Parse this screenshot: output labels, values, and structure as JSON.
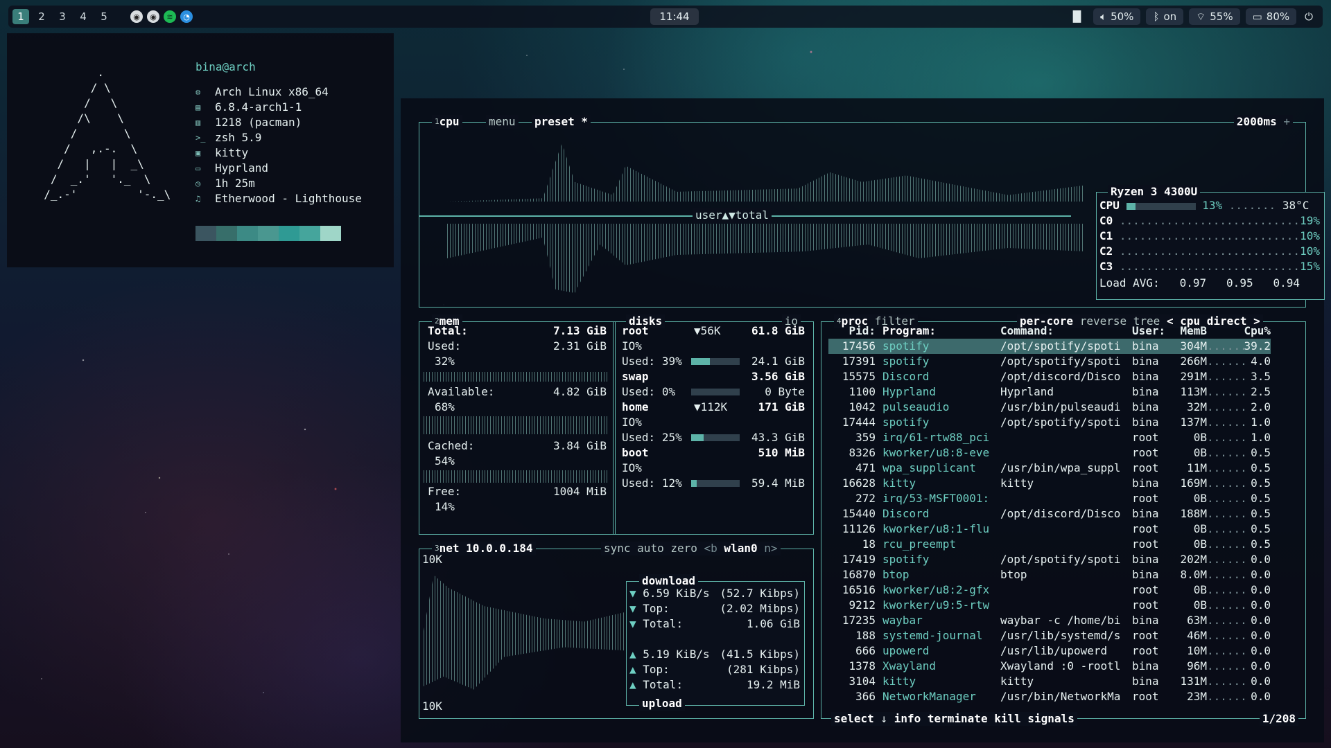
{
  "bar": {
    "workspaces": [
      "1",
      "2",
      "3",
      "4",
      "5"
    ],
    "active_workspace": "1",
    "clock": "11:44",
    "volume": "50%",
    "bluetooth": "on",
    "wifi": "55%",
    "battery": "80%",
    "tray_icons": [
      "obs-icon",
      "obs-icon",
      "spotify-icon",
      "edge-icon"
    ]
  },
  "fetch": {
    "header": "bina@arch",
    "rows": [
      {
        "icon": "arch-icon",
        "value": "Arch Linux x86_64"
      },
      {
        "icon": "kernel-icon",
        "value": "6.8.4-arch1-1"
      },
      {
        "icon": "package-icon",
        "value": "1218 (pacman)"
      },
      {
        "icon": "shell-icon",
        "value": "zsh 5.9"
      },
      {
        "icon": "terminal-icon",
        "value": "kitty"
      },
      {
        "icon": "window-icon",
        "value": "Hyprland"
      },
      {
        "icon": "clock-icon",
        "value": "1h 25m"
      },
      {
        "icon": "music-icon",
        "value": "Etherwood - Lighthouse"
      }
    ],
    "swatches": [
      "#3b5560",
      "#376e6a",
      "#3c8a85",
      "#4a9790",
      "#2f9a94",
      "#45a59c",
      "#9fd6c8"
    ]
  },
  "cpu": {
    "tab_num": "1",
    "tab": "cpu",
    "menu": "menu",
    "preset": "preset *",
    "interval": "2000ms",
    "graph_label": "user▲▼total",
    "model": "Ryzen 3 4300U",
    "rows": [
      {
        "name": "CPU",
        "pct": "13%",
        "temp": "38°C",
        "frac": 0.13
      },
      {
        "name": "C0",
        "pct": "19%"
      },
      {
        "name": "C1",
        "pct": "10%"
      },
      {
        "name": "C2",
        "pct": "10%"
      },
      {
        "name": "C3",
        "pct": "15%"
      }
    ],
    "load_label": "Load AVG:",
    "load": [
      "0.97",
      "0.95",
      "0.94"
    ]
  },
  "mem": {
    "tab_num": "2",
    "tab": "mem",
    "total_label": "Total:",
    "total": "7.13 GiB",
    "used_label": "Used:",
    "used": "2.31 GiB",
    "used_pct": "32%",
    "avail_label": "Available:",
    "avail": "4.82 GiB",
    "avail_pct": "68%",
    "cached_label": "Cached:",
    "cached": "3.84 GiB",
    "cached_pct": "54%",
    "free_label": "Free:",
    "free": "1004 MiB",
    "free_pct": "14%"
  },
  "disks": {
    "tab": "disks",
    "io": "io",
    "items": [
      {
        "name": "root",
        "io": "▼56K",
        "size": "61.8 GiB",
        "io_label": "IO%",
        "used_label": "Used:",
        "used_pct": "39%",
        "frac": 0.39,
        "used": "24.1 GiB"
      },
      {
        "name": "swap",
        "io": "",
        "size": "3.56 GiB",
        "io_label": "",
        "used_label": "Used:",
        "used_pct": "0%",
        "frac": 0.0,
        "used": "0 Byte"
      },
      {
        "name": "home",
        "io": "▼112K",
        "size": "171 GiB",
        "io_label": "IO%",
        "used_label": "Used:",
        "used_pct": "25%",
        "frac": 0.25,
        "used": "43.3 GiB"
      },
      {
        "name": "boot",
        "io": "",
        "size": "510 MiB",
        "io_label": "IO%",
        "used_label": "Used:",
        "used_pct": "12%",
        "frac": 0.12,
        "used": "59.4 MiB"
      }
    ]
  },
  "net": {
    "tab_num": "3",
    "tab": "net",
    "ip": "10.0.0.184",
    "sync": "sync",
    "auto": "auto",
    "zero": "zero",
    "prev": "<b",
    "iface": "wlan0",
    "next": "n>",
    "scale_top": "10K",
    "scale_bottom": "10K",
    "download_label": "download",
    "upload_label": "upload",
    "down_rate": "6.59 KiB/s",
    "down_rate_b": "(52.7 Kibps)",
    "down_top_label": "Top:",
    "down_top": "(2.02 Mibps)",
    "down_total_label": "Total:",
    "down_total": "1.06 GiB",
    "up_rate": "5.19 KiB/s",
    "up_rate_b": "(41.5 Kibps)",
    "up_top_label": "Top:",
    "up_top": "(281 Kibps)",
    "up_total_label": "Total:",
    "up_total": "19.2 MiB"
  },
  "proc": {
    "tab_num": "4",
    "tab": "proc",
    "filter": "filter",
    "percore": "per-core",
    "reverse": "reverse",
    "tree": "tree",
    "sort": "< cpu direct >",
    "headers": {
      "pid": "Pid:",
      "program": "Program:",
      "command": "Command:",
      "user": "User:",
      "mem": "MemB",
      "cpu": "Cpu%"
    },
    "rows": [
      {
        "pid": "17456",
        "program": "spotify",
        "command": "/opt/spotify/spoti",
        "user": "bina",
        "mem": "304M",
        "cpu": "39.2"
      },
      {
        "pid": "17391",
        "program": "spotify",
        "command": "/opt/spotify/spoti",
        "user": "bina",
        "mem": "266M",
        "cpu": "4.0"
      },
      {
        "pid": "15575",
        "program": "Discord",
        "command": "/opt/discord/Disco",
        "user": "bina",
        "mem": "291M",
        "cpu": "3.5"
      },
      {
        "pid": "1100",
        "program": "Hyprland",
        "command": "Hyprland",
        "user": "bina",
        "mem": "113M",
        "cpu": "2.5"
      },
      {
        "pid": "1042",
        "program": "pulseaudio",
        "command": "/usr/bin/pulseaudi",
        "user": "bina",
        "mem": "32M",
        "cpu": "2.0"
      },
      {
        "pid": "17444",
        "program": "spotify",
        "command": "/opt/spotify/spoti",
        "user": "bina",
        "mem": "137M",
        "cpu": "1.0"
      },
      {
        "pid": "359",
        "program": "irq/61-rtw88_pci",
        "command": "",
        "user": "root",
        "mem": "0B",
        "cpu": "1.0"
      },
      {
        "pid": "8326",
        "program": "kworker/u8:8-eve",
        "command": "",
        "user": "root",
        "mem": "0B",
        "cpu": "0.5"
      },
      {
        "pid": "471",
        "program": "wpa_supplicant",
        "command": "/usr/bin/wpa_suppl",
        "user": "root",
        "mem": "11M",
        "cpu": "0.5"
      },
      {
        "pid": "16628",
        "program": "kitty",
        "command": "kitty",
        "user": "bina",
        "mem": "169M",
        "cpu": "0.5"
      },
      {
        "pid": "272",
        "program": "irq/53-MSFT0001:",
        "command": "",
        "user": "root",
        "mem": "0B",
        "cpu": "0.5"
      },
      {
        "pid": "15440",
        "program": "Discord",
        "command": "/opt/discord/Disco",
        "user": "bina",
        "mem": "188M",
        "cpu": "0.5"
      },
      {
        "pid": "11126",
        "program": "kworker/u8:1-flu",
        "command": "",
        "user": "root",
        "mem": "0B",
        "cpu": "0.5"
      },
      {
        "pid": "18",
        "program": "rcu_preempt",
        "command": "",
        "user": "root",
        "mem": "0B",
        "cpu": "0.5"
      },
      {
        "pid": "17419",
        "program": "spotify",
        "command": "/opt/spotify/spoti",
        "user": "bina",
        "mem": "202M",
        "cpu": "0.0"
      },
      {
        "pid": "16870",
        "program": "btop",
        "command": "btop",
        "user": "bina",
        "mem": "8.0M",
        "cpu": "0.0"
      },
      {
        "pid": "16516",
        "program": "kworker/u8:2-gfx",
        "command": "",
        "user": "root",
        "mem": "0B",
        "cpu": "0.0"
      },
      {
        "pid": "9212",
        "program": "kworker/u9:5-rtw",
        "command": "",
        "user": "root",
        "mem": "0B",
        "cpu": "0.0"
      },
      {
        "pid": "17235",
        "program": "waybar",
        "command": "waybar -c /home/bi",
        "user": "bina",
        "mem": "63M",
        "cpu": "0.0"
      },
      {
        "pid": "188",
        "program": "systemd-journal",
        "command": "/usr/lib/systemd/s",
        "user": "root",
        "mem": "46M",
        "cpu": "0.0"
      },
      {
        "pid": "666",
        "program": "upowerd",
        "command": "/usr/lib/upowerd",
        "user": "root",
        "mem": "10M",
        "cpu": "0.0"
      },
      {
        "pid": "1378",
        "program": "Xwayland",
        "command": "Xwayland :0 -rootl",
        "user": "bina",
        "mem": "96M",
        "cpu": "0.0"
      },
      {
        "pid": "3104",
        "program": "kitty",
        "command": "kitty",
        "user": "bina",
        "mem": "131M",
        "cpu": "0.0"
      },
      {
        "pid": "366",
        "program": "NetworkManager",
        "command": "/usr/bin/NetworkMa",
        "user": "root",
        "mem": "23M",
        "cpu": "0.0"
      }
    ],
    "footer": {
      "select": "select",
      "info": "info",
      "terminate": "terminate",
      "kill": "kill",
      "signals": "signals",
      "count": "1/208"
    }
  }
}
